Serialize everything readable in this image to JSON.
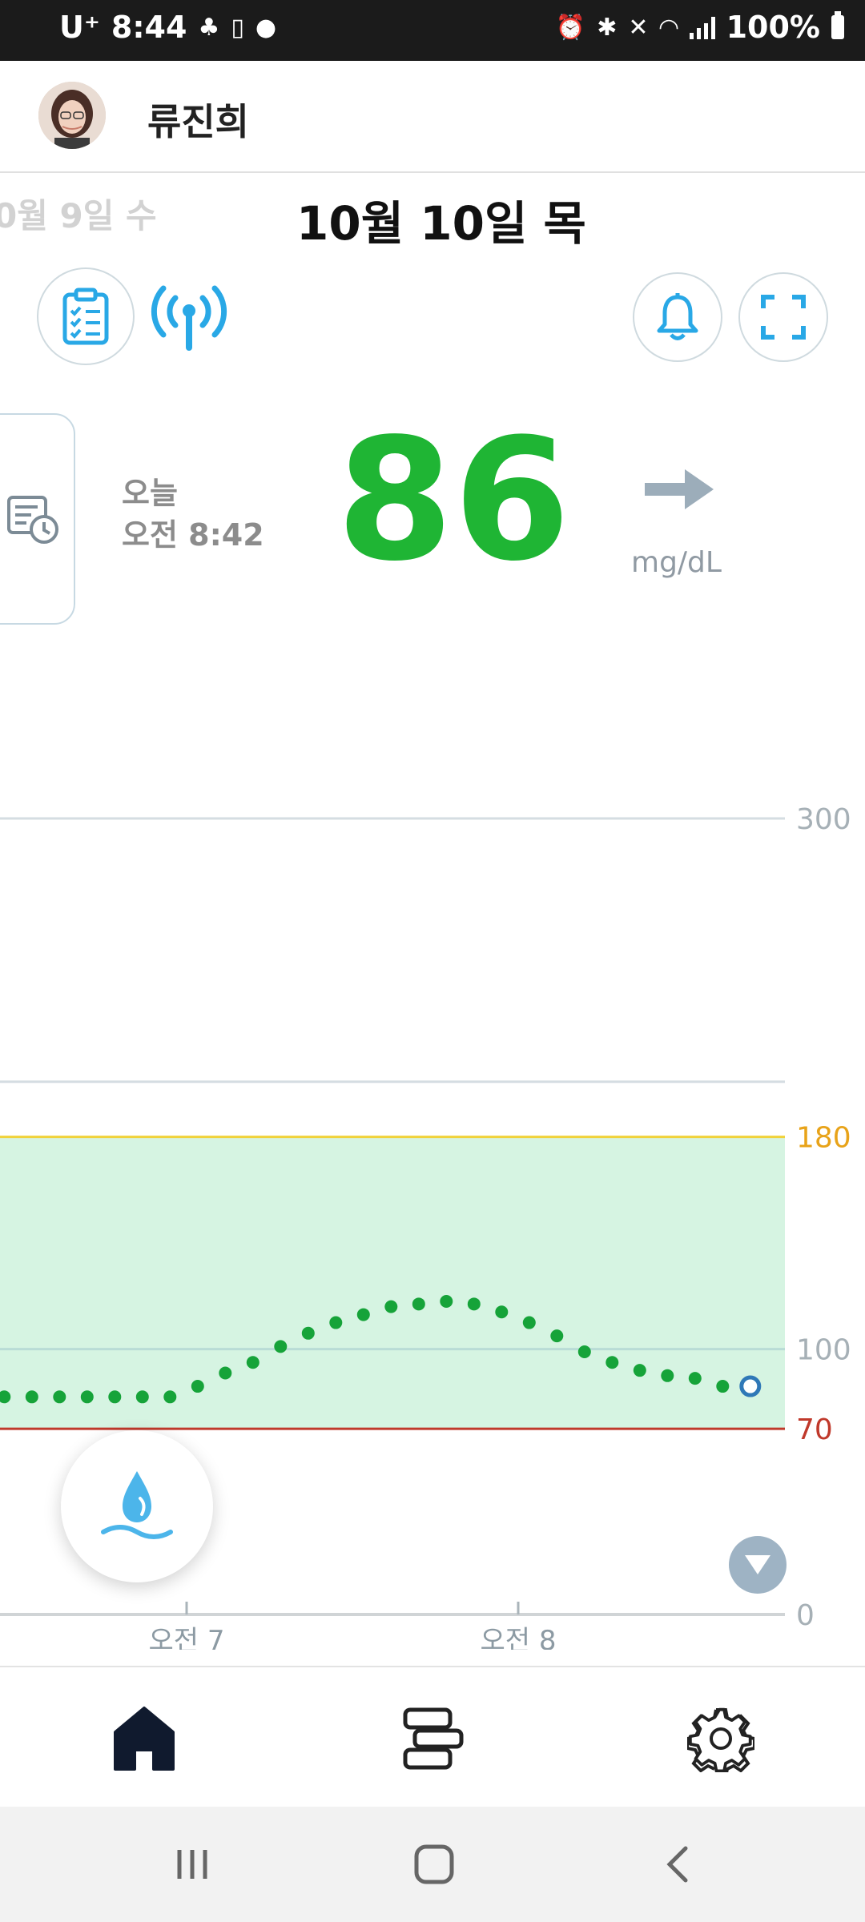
{
  "status_bar": {
    "carrier": "U⁺",
    "time": "8:44",
    "battery": "100%"
  },
  "header": {
    "user_name": "류진희"
  },
  "dates": {
    "previous": "0월 9일 수",
    "current": "10월 10일 목"
  },
  "reading": {
    "day_label": "오늘",
    "time_label": "오전 8:42",
    "value": "86",
    "unit": "mg/dL",
    "trend": "steady-right-arrow"
  },
  "colors": {
    "glucose_green": "#1fb534",
    "accent_blue": "#29a8e6",
    "target_fill": "#d6f4e2",
    "high_line": "#f0d23a",
    "low_line": "#c0392b",
    "high_label": "#e8a319",
    "low_label": "#c0392b",
    "point_green": "#16a339"
  },
  "chart_data": {
    "type": "scatter",
    "y_axis_labels": [
      "300",
      "180",
      "100",
      "70",
      "0"
    ],
    "x_axis_labels": [
      "오전 7",
      "오전 8"
    ],
    "ylim": [
      0,
      300
    ],
    "target_range": [
      70,
      180
    ],
    "series": [
      {
        "x": [
          "06:22",
          "06:27",
          "06:32",
          "06:37",
          "06:42",
          "06:47",
          "06:52",
          "06:57",
          "07:02",
          "07:07",
          "07:12",
          "07:17",
          "07:22",
          "07:27",
          "07:32",
          "07:37",
          "07:42",
          "07:47",
          "07:52",
          "07:57",
          "08:02",
          "08:07",
          "08:12",
          "08:17",
          "08:22",
          "08:27",
          "08:32",
          "08:37"
        ],
        "values": [
          82,
          82,
          82,
          82,
          82,
          82,
          82,
          82,
          86,
          91,
          95,
          101,
          106,
          110,
          113,
          116,
          117,
          118,
          117,
          114,
          110,
          105,
          99,
          95,
          92,
          90,
          89,
          86
        ]
      }
    ],
    "current_point": {
      "x": "08:42",
      "value": 86
    }
  },
  "icons": {
    "checklist": "clipboard-checklist-icon",
    "signal": "broadcast-signal-icon",
    "bell": "bell-icon",
    "fullscreen": "fullscreen-icon",
    "history": "report-clock-icon",
    "water": "water-drop-icon",
    "scroll": "chevron-down-icon",
    "home": "home-icon",
    "list": "list-layout-icon",
    "settings": "gear-icon"
  }
}
